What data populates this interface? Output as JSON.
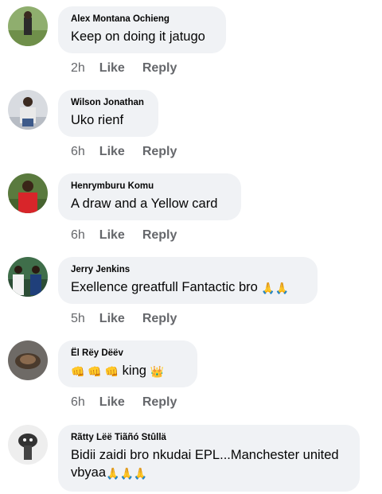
{
  "colors": {
    "bubble_bg": "#f0f2f5",
    "meta_text": "#65676b",
    "text": "#050505"
  },
  "comments": [
    {
      "author": "Alex Montana Ochieng",
      "text": "Keep on doing it jatugo",
      "time": "2h",
      "like_label": "Like",
      "reply_label": "Reply",
      "avatar": "avatar-photo"
    },
    {
      "author": "Wilson Jonathan",
      "text": "Uko rienf",
      "time": "6h",
      "like_label": "Like",
      "reply_label": "Reply",
      "avatar": "avatar-photo"
    },
    {
      "author": "Henrymburu Komu",
      "text": "A draw and a Yellow card",
      "time": "6h",
      "like_label": "Like",
      "reply_label": "Reply",
      "avatar": "avatar-photo"
    },
    {
      "author": "Jerry Jenkins",
      "text": "Exellence greatfull Fantactic bro",
      "emoji": "🙏🙏",
      "time": "5h",
      "like_label": "Like",
      "reply_label": "Reply",
      "avatar": "avatar-photo"
    },
    {
      "author": "Ël Rëy Dëëv",
      "text_prefix": "👊 👊 👊",
      "text": "king",
      "emoji": "👑",
      "time": "6h",
      "like_label": "Like",
      "reply_label": "Reply",
      "avatar": "avatar-photo"
    },
    {
      "author": "Rãtty Lëë Tiãñó Stûllä",
      "text": "Bidii zaidi bro nkudai EPL...Manchester united vbyaa",
      "emoji": "🙏🙏🙏",
      "avatar": "avatar-photo"
    }
  ]
}
